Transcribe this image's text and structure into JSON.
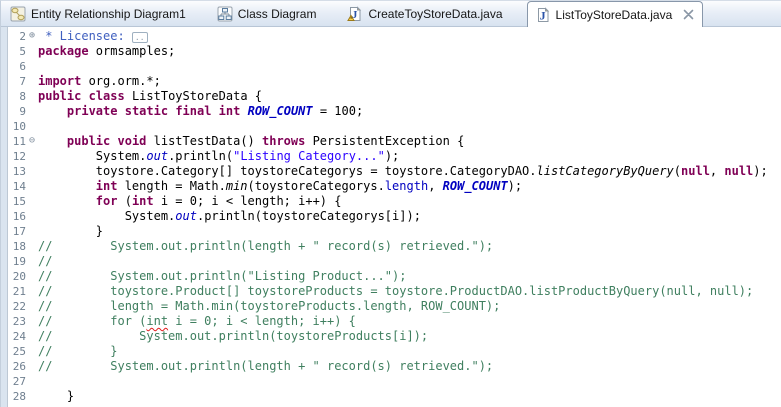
{
  "window_title": "Eclipse editor - ListToyStoreData.java",
  "tabbar": {
    "tabs": [
      {
        "label": "Entity Relationship Diagram1",
        "icon": "er-diagram-icon",
        "active": false
      },
      {
        "label": "Class Diagram",
        "icon": "class-diagram-icon",
        "active": false
      },
      {
        "label": "CreateToyStoreData.java",
        "icon": "java-file-warning-icon",
        "active": false
      },
      {
        "label": "ListToyStoreData.java",
        "icon": "java-file-icon",
        "active": true,
        "closable": true,
        "close_icon": "close-icon"
      }
    ]
  },
  "colors": {
    "keyword": "#7f0055",
    "string": "#2a00ff",
    "comment": "#3f7f5f",
    "javadoc": "#3f5fbf",
    "field": "#0000c0",
    "line_number": "#6f7f8f",
    "tabbar_bg_bottom": "#d8e3f0",
    "active_tab_border": "#8897aa",
    "squiggle": "#e01b1b"
  },
  "icons": {
    "fold_collapsed_glyph": "⊕",
    "fold_expanded_glyph": "⊖",
    "folded_placeholder": ".."
  },
  "editor": {
    "lines": [
      {
        "n": "2",
        "fold": "plus",
        "seg": [
          {
            "t": " * Licensee: ",
            "c": "j"
          },
          {
            "t": "..",
            "c": "fb"
          }
        ]
      },
      {
        "n": "5",
        "fold": "",
        "seg": [
          {
            "t": "package",
            "c": "k"
          },
          {
            "t": " ormsamples;",
            "c": "p"
          }
        ]
      },
      {
        "n": "6",
        "fold": "",
        "seg": []
      },
      {
        "n": "7",
        "fold": "",
        "seg": [
          {
            "t": "import",
            "c": "k"
          },
          {
            "t": " org.orm.*;",
            "c": "p"
          }
        ]
      },
      {
        "n": "8",
        "fold": "",
        "seg": [
          {
            "t": "public",
            "c": "k"
          },
          {
            "t": " ",
            "c": "p"
          },
          {
            "t": "class",
            "c": "k"
          },
          {
            "t": " ListToyStoreData {",
            "c": "p"
          }
        ]
      },
      {
        "n": "9",
        "fold": "",
        "seg": [
          {
            "t": "    ",
            "c": "p"
          },
          {
            "t": "private",
            "c": "k"
          },
          {
            "t": " ",
            "c": "p"
          },
          {
            "t": "static",
            "c": "k"
          },
          {
            "t": " ",
            "c": "p"
          },
          {
            "t": "final",
            "c": "k"
          },
          {
            "t": " ",
            "c": "p"
          },
          {
            "t": "int",
            "c": "k"
          },
          {
            "t": " ",
            "c": "p"
          },
          {
            "t": "ROW_COUNT",
            "c": "ct"
          },
          {
            "t": " = 100;",
            "c": "p"
          }
        ]
      },
      {
        "n": "10",
        "fold": "",
        "seg": []
      },
      {
        "n": "11",
        "fold": "minus",
        "seg": [
          {
            "t": "    ",
            "c": "p"
          },
          {
            "t": "public",
            "c": "k"
          },
          {
            "t": " ",
            "c": "p"
          },
          {
            "t": "void",
            "c": "k"
          },
          {
            "t": " listTestData() ",
            "c": "p"
          },
          {
            "t": "throws",
            "c": "k"
          },
          {
            "t": " PersistentException {",
            "c": "p"
          }
        ]
      },
      {
        "n": "12",
        "fold": "",
        "seg": [
          {
            "t": "        System.",
            "c": "p"
          },
          {
            "t": "out",
            "c": "sf"
          },
          {
            "t": ".println(",
            "c": "p"
          },
          {
            "t": "\"Listing Category...\"",
            "c": "s"
          },
          {
            "t": ");",
            "c": "p"
          }
        ]
      },
      {
        "n": "13",
        "fold": "",
        "seg": [
          {
            "t": "        toystore.Category[] toystoreCategorys = toystore.CategoryDAO.",
            "c": "p"
          },
          {
            "t": "listCategoryByQuery",
            "c": "sm"
          },
          {
            "t": "(",
            "c": "p"
          },
          {
            "t": "null",
            "c": "k"
          },
          {
            "t": ", ",
            "c": "p"
          },
          {
            "t": "null",
            "c": "k"
          },
          {
            "t": ");",
            "c": "p"
          }
        ]
      },
      {
        "n": "14",
        "fold": "",
        "seg": [
          {
            "t": "        ",
            "c": "p"
          },
          {
            "t": "int",
            "c": "k"
          },
          {
            "t": " length = Math.",
            "c": "p"
          },
          {
            "t": "min",
            "c": "sm"
          },
          {
            "t": "(toystoreCategorys.",
            "c": "p"
          },
          {
            "t": "length",
            "c": "f"
          },
          {
            "t": ", ",
            "c": "p"
          },
          {
            "t": "ROW_COUNT",
            "c": "ct"
          },
          {
            "t": ");",
            "c": "p"
          }
        ]
      },
      {
        "n": "15",
        "fold": "",
        "seg": [
          {
            "t": "        ",
            "c": "p"
          },
          {
            "t": "for",
            "c": "k"
          },
          {
            "t": " (",
            "c": "p"
          },
          {
            "t": "int",
            "c": "k"
          },
          {
            "t": " i = 0; i < length; i++) {",
            "c": "p"
          }
        ]
      },
      {
        "n": "16",
        "fold": "",
        "seg": [
          {
            "t": "            System.",
            "c": "p"
          },
          {
            "t": "out",
            "c": "sf"
          },
          {
            "t": ".println(toystoreCategorys[i]);",
            "c": "p"
          }
        ]
      },
      {
        "n": "17",
        "fold": "",
        "seg": [
          {
            "t": "        }",
            "c": "p"
          }
        ]
      },
      {
        "n": "18",
        "fold": "",
        "seg": [
          {
            "t": "//        System.out.println(length + \" record(s) retrieved.\");",
            "c": "c"
          }
        ]
      },
      {
        "n": "19",
        "fold": "",
        "seg": [
          {
            "t": "//",
            "c": "c"
          }
        ]
      },
      {
        "n": "20",
        "fold": "",
        "seg": [
          {
            "t": "//        System.out.println(\"Listing Product...\");",
            "c": "c"
          }
        ]
      },
      {
        "n": "21",
        "fold": "",
        "seg": [
          {
            "t": "//        toystore.Product[] toystoreProducts = toystore.ProductDAO.listProductByQuery(null, null);",
            "c": "c"
          }
        ]
      },
      {
        "n": "22",
        "fold": "",
        "seg": [
          {
            "t": "//        length = Math.min(toystoreProducts.length, ROW_COUNT);",
            "c": "c"
          }
        ]
      },
      {
        "n": "23",
        "fold": "",
        "seg": [
          {
            "t": "//        for (",
            "c": "c"
          },
          {
            "t": "int",
            "c": "csq"
          },
          {
            "t": " i = 0; i < length; i++) {",
            "c": "c"
          }
        ]
      },
      {
        "n": "24",
        "fold": "",
        "seg": [
          {
            "t": "//            System.out.println(toystoreProducts[i]);",
            "c": "c"
          }
        ]
      },
      {
        "n": "25",
        "fold": "",
        "seg": [
          {
            "t": "//        }",
            "c": "c"
          }
        ]
      },
      {
        "n": "26",
        "fold": "",
        "seg": [
          {
            "t": "//        System.out.println(length + \" record(s) retrieved.\");",
            "c": "c"
          }
        ]
      },
      {
        "n": "27",
        "fold": "",
        "seg": []
      },
      {
        "n": "28",
        "fold": "",
        "seg": [
          {
            "t": "    }",
            "c": "p"
          }
        ]
      }
    ]
  }
}
